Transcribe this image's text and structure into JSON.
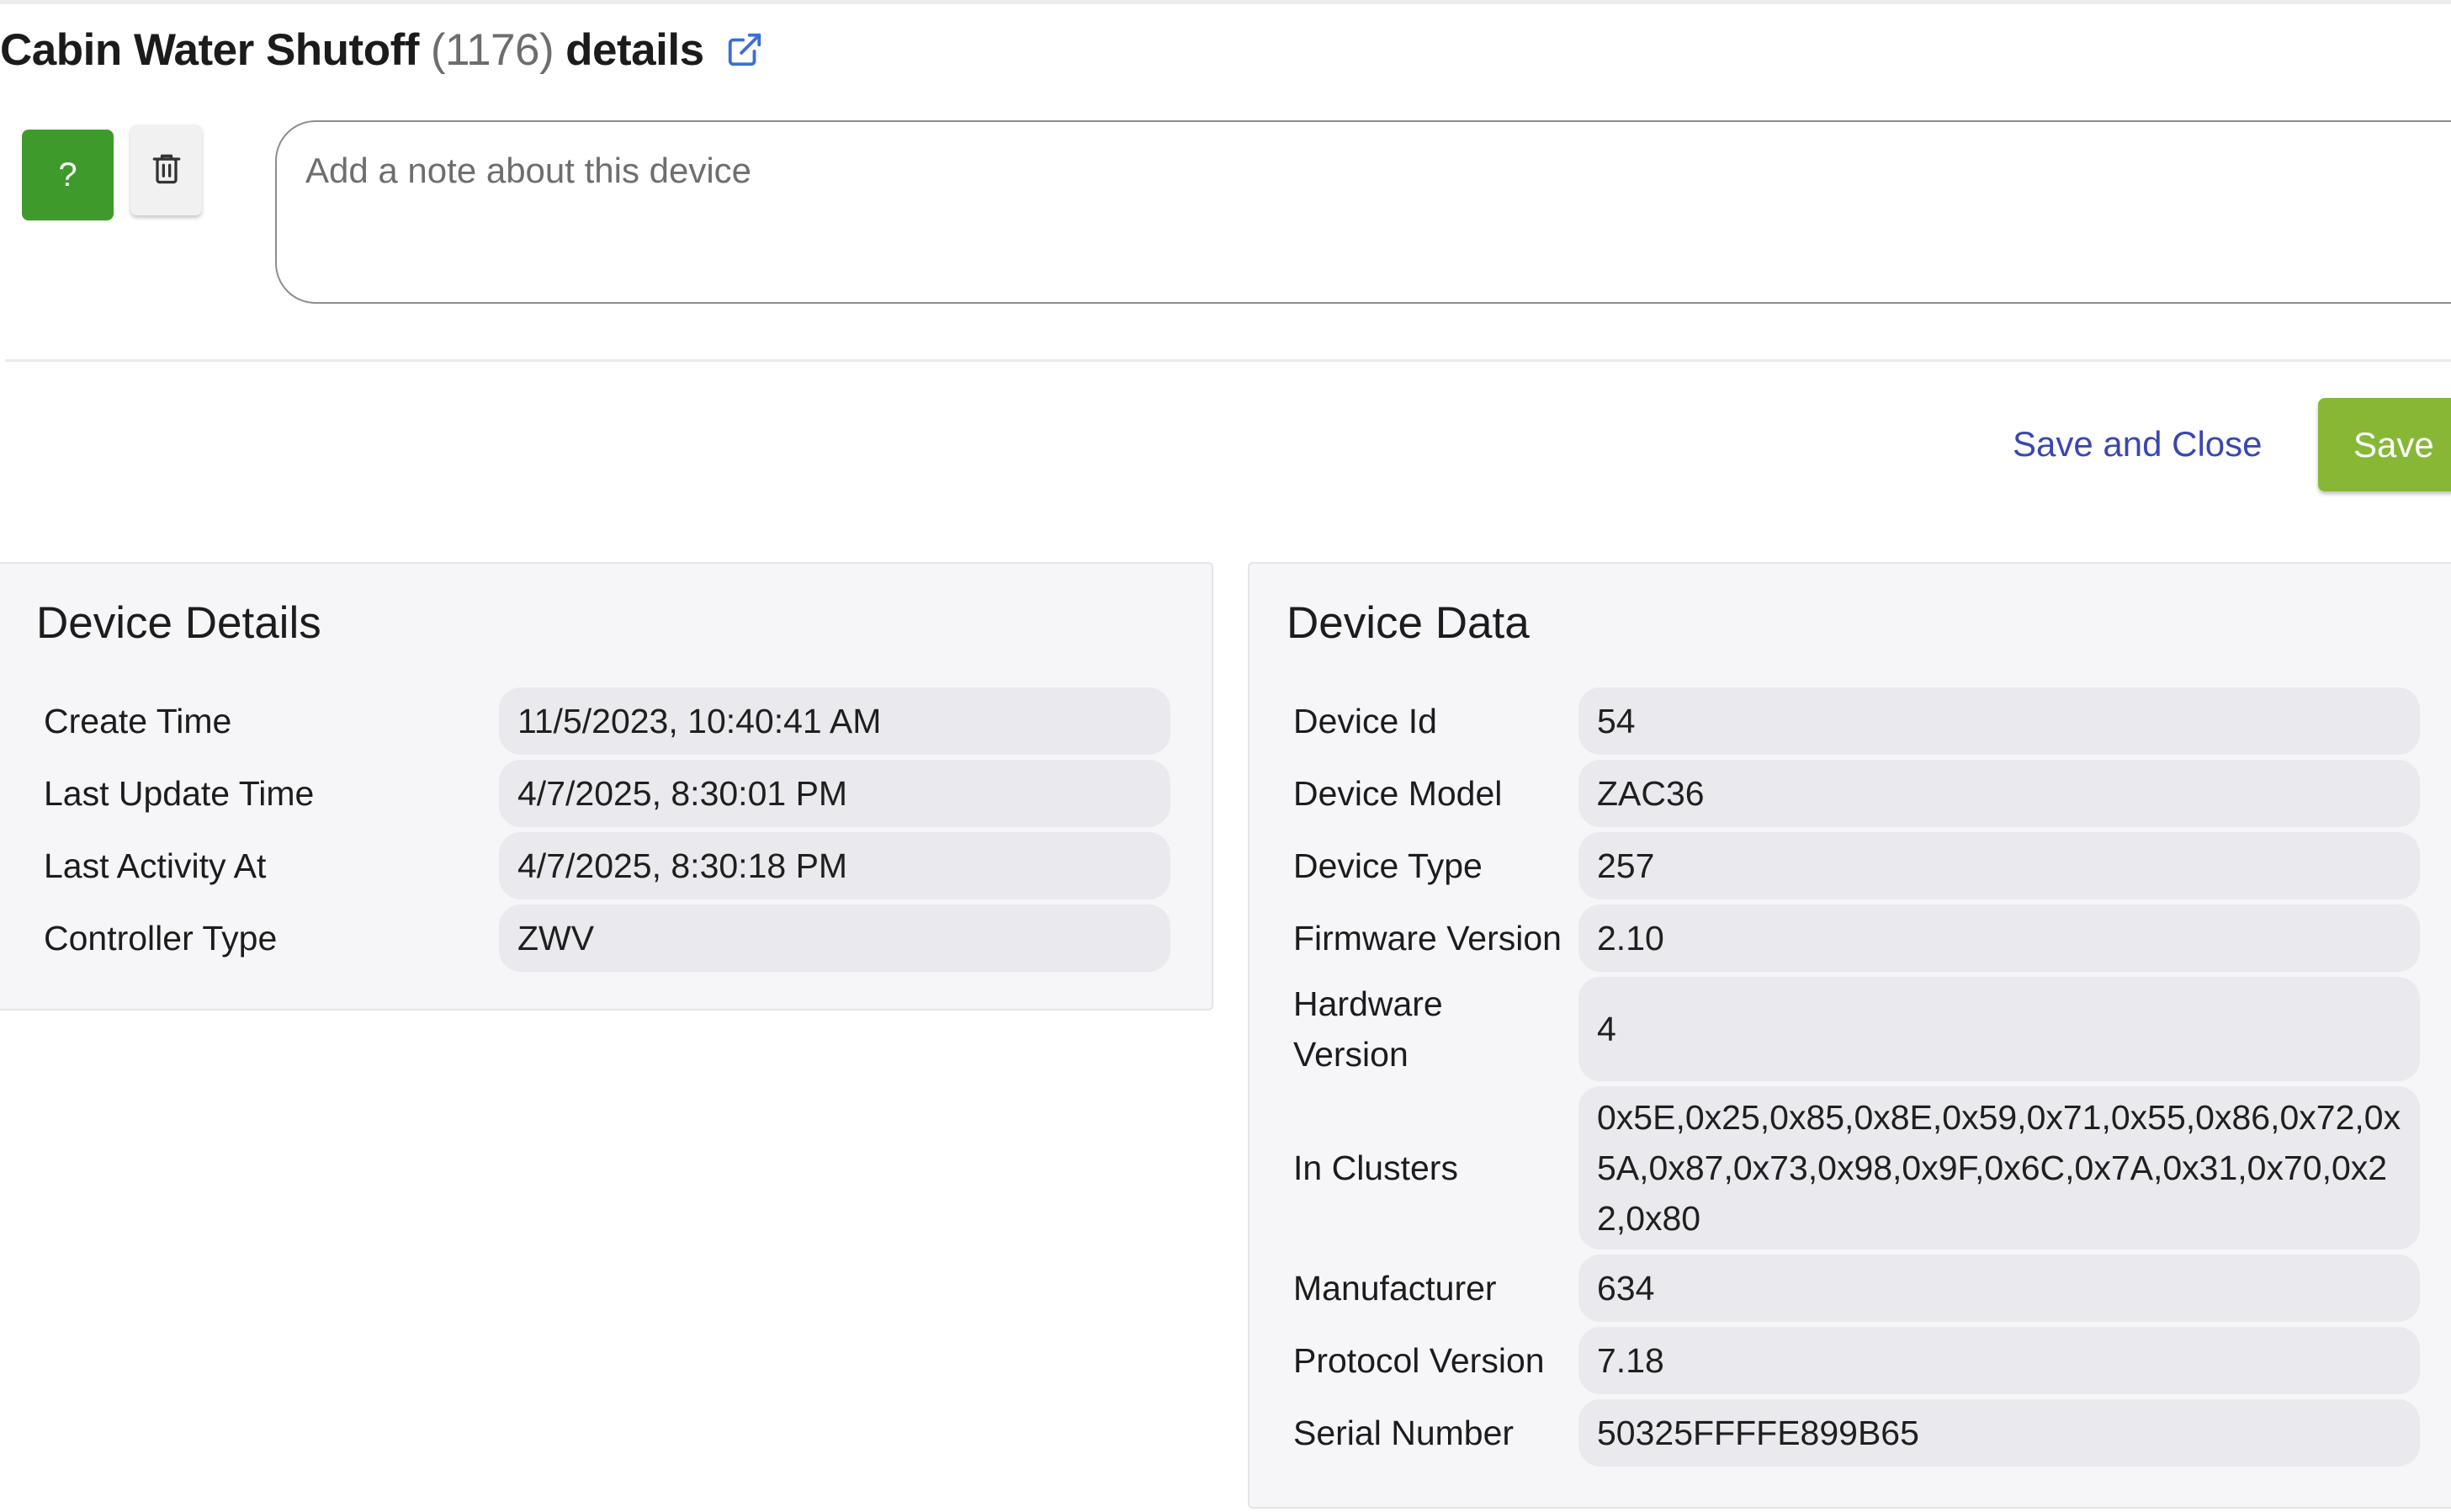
{
  "header": {
    "device_name": "Cabin Water Shutoff",
    "device_count": "(1176)",
    "title_suffix": "details",
    "external_link_icon": "external-link-icon"
  },
  "actions": {
    "help_label": "?",
    "delete_icon": "trash-icon",
    "note_placeholder": "Add a note about this device",
    "note_value": "",
    "save_and_close_label": "Save and Close",
    "save_label": "Save"
  },
  "device_details": {
    "title": "Device Details",
    "rows": [
      {
        "label": "Create Time",
        "value": "11/5/2023, 10:40:41 AM"
      },
      {
        "label": "Last Update Time",
        "value": "4/7/2025, 8:30:01 PM"
      },
      {
        "label": "Last Activity At",
        "value": "4/7/2025, 8:30:18 PM"
      },
      {
        "label": "Controller Type",
        "value": "ZWV"
      }
    ]
  },
  "device_data": {
    "title": "Device Data",
    "rows": [
      {
        "label": "Device Id",
        "value": "54"
      },
      {
        "label": "Device Model",
        "value": "ZAC36"
      },
      {
        "label": "Device Type",
        "value": "257"
      },
      {
        "label": "Firmware Version",
        "value": "2.10"
      },
      {
        "label": "Hardware Version",
        "value": "4"
      },
      {
        "label": "In Clusters",
        "value": "0x5E,0x25,0x85,0x8E,0x59,0x71,0x55,0x86,0x72,0x5A,0x87,0x73,0x98,0x9F,0x6C,0x7A,0x31,0x70,0x22,0x80"
      },
      {
        "label": "Manufacturer",
        "value": "634"
      },
      {
        "label": "Protocol Version",
        "value": "7.18"
      },
      {
        "label": "Serial Number",
        "value": "50325FFFFE899B65"
      }
    ]
  },
  "colors": {
    "help_button": "#3f9a2c",
    "save_button": "#86b836",
    "link_text": "#3a47b0",
    "external_link_icon": "#3b6fd4",
    "panel_bg": "#f6f6f9",
    "value_bg": "#e9e9ee"
  }
}
